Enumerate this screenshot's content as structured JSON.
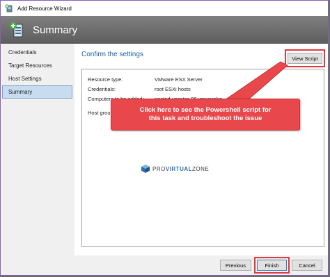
{
  "window": {
    "title": "Add Resource Wizard"
  },
  "banner": {
    "heading": "Summary"
  },
  "sidebar": {
    "items": [
      {
        "label": "Credentials"
      },
      {
        "label": "Target Resources"
      },
      {
        "label": "Host Settings"
      },
      {
        "label": "Summary"
      }
    ],
    "selected": "Summary"
  },
  "content": {
    "section_title": "Confirm the settings",
    "view_script_label": "View Script",
    "settings": [
      {
        "label": "Resource type:",
        "value": "VMware ESX Server"
      },
      {
        "label": "Credentials:",
        "value": "root ESXi hosts"
      },
      {
        "label": "Computers to be added:",
        "value": "nested-vcenter-06.vmwareho"
      },
      {
        "label": "Host grou",
        "value": ""
      }
    ],
    "logo_text_plain": "PRO",
    "logo_text_bold": "VIRTUAL",
    "logo_text_end": "ZONE"
  },
  "callout": {
    "line1": "Click here to see the Powershell script for",
    "line2": "this task and troubleshoot the issue"
  },
  "footer": {
    "previous_label": "Previous",
    "finish_label": "Finish",
    "cancel_label": "Cancel"
  },
  "colors": {
    "accent": "#1f5fa8",
    "highlight": "#e0383e",
    "callout_fill": "#e8474b",
    "selected_nav": "#c8dcf0"
  },
  "icons": {
    "app": "add-resource-icon",
    "banner": "server-add-icon",
    "logo": "cube-logo-icon"
  }
}
